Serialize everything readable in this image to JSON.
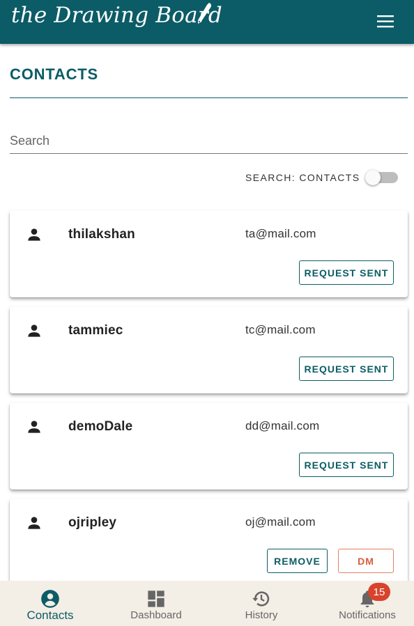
{
  "header": {
    "logo_text": "the Drawing Board",
    "menu_icon": "hamburger-menu-icon",
    "background": "#0b5c66"
  },
  "page": {
    "title": "CONTACTS"
  },
  "search": {
    "placeholder": "Search",
    "value": "",
    "toggle_label": "SEARCH: CONTACTS",
    "toggle_on": false
  },
  "contacts": [
    {
      "name": "thilakshan",
      "email": "ta@mail.com",
      "action": "REQUEST SENT"
    },
    {
      "name": "tammiec",
      "email": "tc@mail.com",
      "action": "REQUEST SENT"
    },
    {
      "name": "demoDale",
      "email": "dd@mail.com",
      "action": "REQUEST SENT"
    },
    {
      "name": "ojripley",
      "email": "oj@mail.com",
      "remove_label": "REMOVE",
      "dm_label": "DM"
    }
  ],
  "nav": {
    "items": [
      {
        "label": "Contacts",
        "icon": "account-circle-icon",
        "active": true
      },
      {
        "label": "Dashboard",
        "icon": "dashboard-icon",
        "active": false
      },
      {
        "label": "History",
        "icon": "history-icon",
        "active": false
      },
      {
        "label": "Notifications",
        "icon": "bell-icon",
        "active": false,
        "badge": "15"
      }
    ]
  },
  "colors": {
    "primary": "#0b5c66",
    "accent": "#d85e3a",
    "badge": "#d8432b",
    "nav_background": "#f3eee6"
  }
}
